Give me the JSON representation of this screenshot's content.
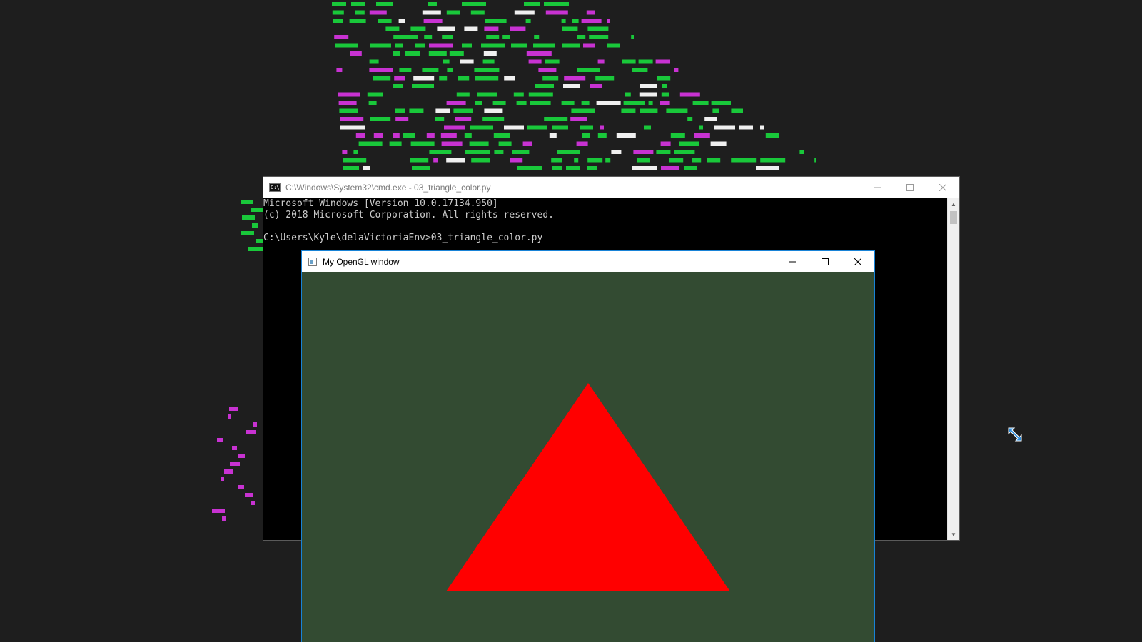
{
  "colors": {
    "desktop_bg": "#1e1e1e",
    "wallpaper_green": "#19c83a",
    "wallpaper_magenta": "#c832d2",
    "wallpaper_white": "#f0f0f0",
    "gl_clear": "#334b32",
    "triangle": "#ff0000",
    "accent_border": "#1883d7"
  },
  "cmd_window": {
    "title": "C:\\Windows\\System32\\cmd.exe - 03_triangle_color.py",
    "icon": "cmd-icon",
    "icon_text": "C:\\",
    "lines": [
      "Microsoft Windows [Version 10.0.17134.950]",
      "(c) 2018 Microsoft Corporation. All rights reserved.",
      "",
      "C:\\Users\\Kyle\\delaVictoriaEnv>03_triangle_color.py"
    ]
  },
  "gl_window": {
    "title": "My OpenGL window",
    "icon": "app-window-icon",
    "scene": {
      "shape": "triangle",
      "color": "#ff0000"
    }
  },
  "cursor": {
    "icon": "move-cursor-icon"
  }
}
